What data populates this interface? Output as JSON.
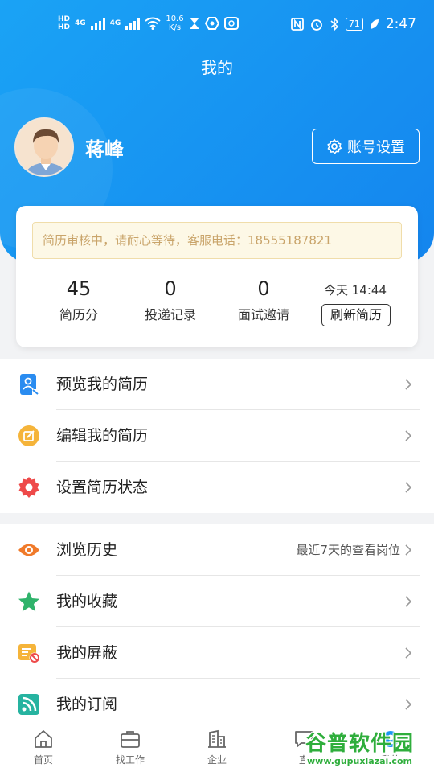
{
  "status_bar": {
    "hd1": "HD",
    "hd2": "HD",
    "net1": "4G",
    "net2": "4G",
    "speed_value": "10.6",
    "speed_unit": "K/s",
    "battery": "71",
    "time": "2:47"
  },
  "page_title": "我的",
  "profile": {
    "name": "蒋峰",
    "account_settings_label": "账号设置"
  },
  "notice": "简历审核中，请耐心等待，客服电话：18555187821",
  "stats": [
    {
      "value": "45",
      "label": "简历分"
    },
    {
      "value": "0",
      "label": "投递记录"
    },
    {
      "value": "0",
      "label": "面试邀请"
    }
  ],
  "refresh": {
    "time_text": "今天 14:44",
    "button_label": "刷新简历"
  },
  "menu_group1": [
    {
      "label": "预览我的简历",
      "icon": "resume-preview-icon"
    },
    {
      "label": "编辑我的简历",
      "icon": "edit-icon"
    },
    {
      "label": "设置简历状态",
      "icon": "gear-icon"
    }
  ],
  "menu_group2": [
    {
      "label": "浏览历史",
      "sub": "最近7天的查看岗位",
      "icon": "eye-icon"
    },
    {
      "label": "我的收藏",
      "icon": "star-icon"
    },
    {
      "label": "我的屏蔽",
      "icon": "block-icon"
    },
    {
      "label": "我的订阅",
      "icon": "rss-icon"
    }
  ],
  "bottom_nav": [
    {
      "label": "首页",
      "icon": "home-icon"
    },
    {
      "label": "找工作",
      "icon": "briefcase-icon"
    },
    {
      "label": "企业",
      "icon": "building-icon"
    },
    {
      "label": "直",
      "icon": "chat-icon"
    },
    {
      "label": "我的",
      "icon": "user-icon"
    }
  ],
  "watermark": {
    "title": "谷普软件园",
    "url": "www.gupuxlazai.com"
  },
  "colors": {
    "header_blue": "#1a96f2",
    "notice_bg": "#fdf8e6",
    "notice_text": "#c9a46a"
  }
}
